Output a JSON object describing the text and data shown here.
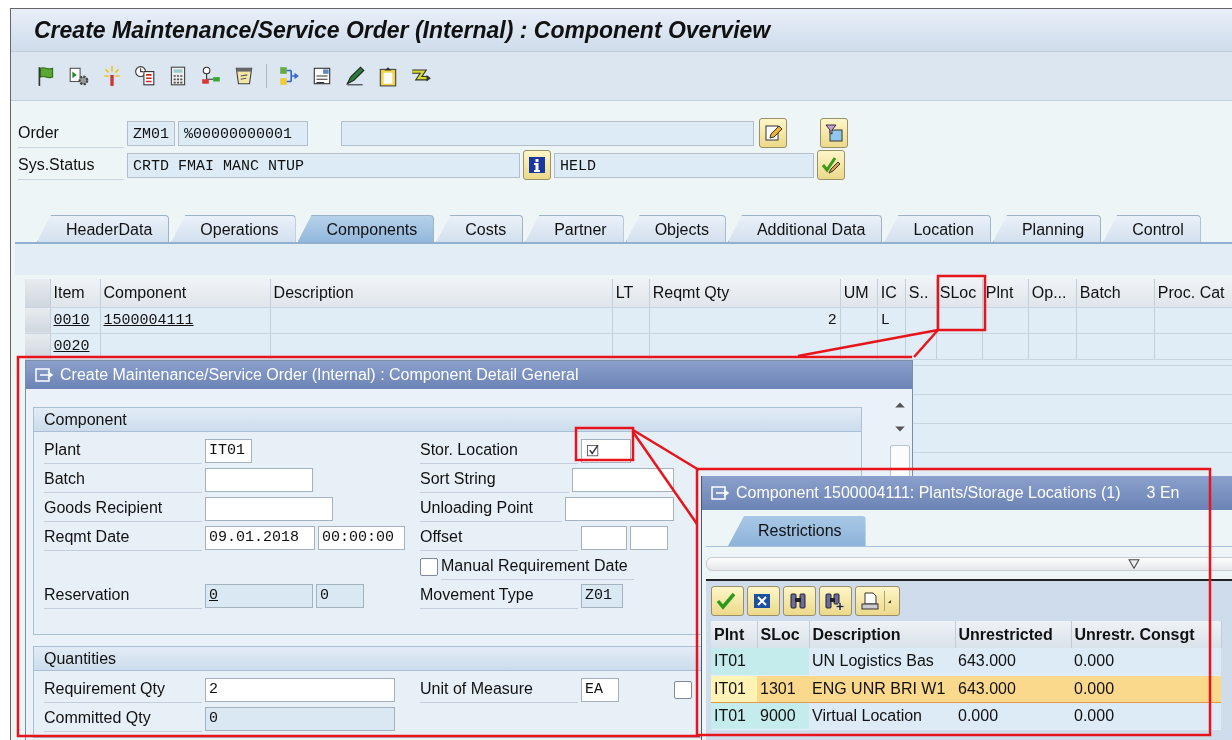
{
  "window": {
    "title": "Create Maintenance/Service Order (Internal) : Component Overview"
  },
  "header": {
    "order_label": "Order",
    "order_type": "ZM01",
    "order_number": "%00000000001",
    "status_label": "Sys.Status",
    "system_status": "CRTD FMAI MANC NTUP",
    "user_status": "HELD"
  },
  "tabs": [
    {
      "label": "HeaderData",
      "selected": false
    },
    {
      "label": "Operations",
      "selected": false
    },
    {
      "label": "Components",
      "selected": true
    },
    {
      "label": "Costs",
      "selected": false
    },
    {
      "label": "Partner",
      "selected": false
    },
    {
      "label": "Objects",
      "selected": false
    },
    {
      "label": "Additional Data",
      "selected": false
    },
    {
      "label": "Location",
      "selected": false
    },
    {
      "label": "Planning",
      "selected": false
    },
    {
      "label": "Control",
      "selected": false
    }
  ],
  "table": {
    "columns": [
      "Item",
      "Component",
      "Description",
      "LT",
      "Reqmt Qty",
      "UM",
      "IC",
      "S..",
      "SLoc",
      "Plnt",
      "Op...",
      "Batch",
      "Proc. Cat"
    ],
    "rows": [
      {
        "item": "0010",
        "component": "1500004111",
        "reqmt_qty": "2",
        "ic": "L"
      },
      {
        "item": "0020"
      }
    ]
  },
  "detail_dialog": {
    "title": "Create Maintenance/Service Order (Internal) : Component Detail General",
    "groups": [
      {
        "title": "Component",
        "rows": [
          {
            "left": {
              "kind": "field",
              "label": "Plant",
              "readonly": false,
              "inputs": [
                {
                  "kind": "text",
                  "value": "IT01"
                }
              ]
            },
            "right": {
              "kind": "field",
              "label": "Stor. Location",
              "readonly": false,
              "inputs": [
                {
                  "kind": "value_help"
                }
              ]
            }
          },
          {
            "left": {
              "kind": "field",
              "label": "Batch",
              "readonly": false,
              "inputs": [
                {
                  "kind": "text"
                }
              ]
            },
            "right": {
              "kind": "field",
              "label": "Sort String",
              "readonly": false,
              "inputs": [
                {
                  "kind": "text"
                }
              ]
            }
          },
          {
            "left": {
              "kind": "field",
              "label": "Goods Recipient",
              "readonly": false,
              "inputs": [
                {
                  "kind": "text"
                }
              ]
            },
            "right": {
              "kind": "field",
              "label": "Unloading Point",
              "readonly": false,
              "inputs": [
                {
                  "kind": "text"
                }
              ]
            }
          },
          {
            "left": {
              "kind": "field",
              "label": "Reqmt Date",
              "readonly": false,
              "inputs": [
                {
                  "kind": "text",
                  "value": "09.01.2018"
                },
                {
                  "kind": "text",
                  "value": "00:00:00"
                }
              ]
            },
            "right": {
              "kind": "field",
              "label": "Offset",
              "readonly": false,
              "inputs": [
                {
                  "kind": "text"
                },
                {
                  "kind": "text"
                }
              ]
            }
          },
          {
            "right": {
              "kind": "checkbox",
              "label": "Manual Requirement Date",
              "checked": false
            }
          },
          {
            "left": {
              "kind": "field",
              "label": "Reservation",
              "readonly": true,
              "inputs": [
                {
                  "kind": "text",
                  "value": "0",
                  "link": true
                },
                {
                  "kind": "text",
                  "value": "0"
                }
              ]
            },
            "right": {
              "kind": "field",
              "label": "Movement Type",
              "readonly": true,
              "inputs": [
                {
                  "kind": "text",
                  "value": "Z01"
                }
              ]
            }
          }
        ]
      },
      {
        "title": "Quantities",
        "rows": [
          {
            "left": {
              "kind": "field",
              "label": "Requirement Qty",
              "readonly": false,
              "inputs": [
                {
                  "kind": "text",
                  "value": "2"
                }
              ]
            },
            "right": {
              "kind": "field",
              "label": "Unit of Measure",
              "readonly": false,
              "inputs": [
                {
                  "kind": "text",
                  "value": "EA"
                }
              ]
            },
            "extra": {
              "kind": "checkbox",
              "checked": false
            }
          },
          {
            "left": {
              "kind": "field",
              "label": "Committed Qty",
              "readonly": true,
              "inputs": [
                {
                  "kind": "text",
                  "value": "0"
                }
              ]
            }
          }
        ]
      }
    ]
  },
  "locations_dialog": {
    "title": "Component 1500004111: Plants/Storage Locations (1)",
    "entries": "3 En",
    "tabs": [
      {
        "label": "Restrictions",
        "selected": true
      }
    ],
    "columns": [
      "Plnt",
      "SLoc",
      "Description",
      "Unrestricted",
      "Unrestr. Consgt"
    ],
    "rows": [
      {
        "selected": false,
        "cells": [
          "IT01",
          null,
          "UN Logistics Bas",
          "643.000",
          "0.000"
        ]
      },
      {
        "selected": true,
        "cells": [
          "IT01",
          "1301",
          "ENG UNR BRI W1",
          "643.000",
          "0.000"
        ]
      },
      {
        "selected": false,
        "cells": [
          "IT01",
          "9000",
          "Virtual Location",
          "0.000",
          "0.000"
        ]
      }
    ]
  }
}
